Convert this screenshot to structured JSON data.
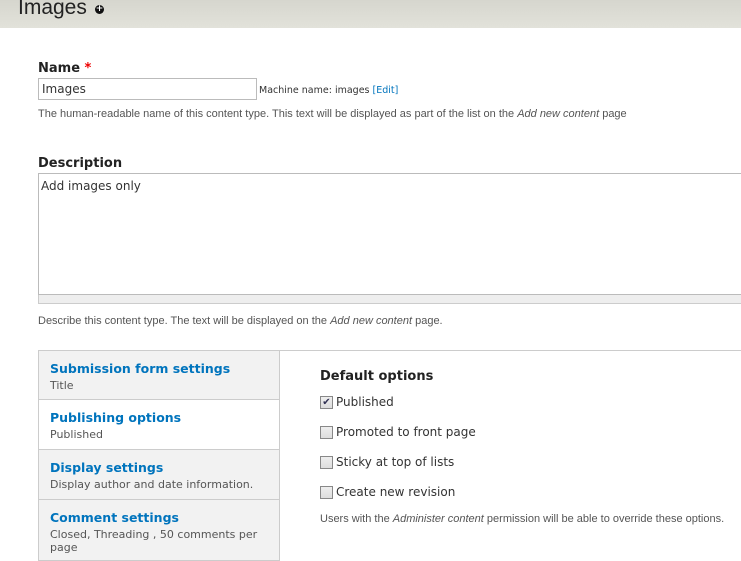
{
  "header": {
    "title": "Images",
    "add_icon": "plus-circle-icon"
  },
  "name": {
    "label": "Name",
    "required": "*",
    "value": "Images",
    "machine_prefix": "Machine name: images",
    "machine_edit": "[Edit]",
    "help_pre": "The human-readable name of this content type. This text will be displayed as part of the list on the ",
    "help_em": "Add new content",
    "help_post": " page"
  },
  "description": {
    "label": "Description",
    "value": "Add images only",
    "help_pre": "Describe this content type. The text will be displayed on the ",
    "help_em": "Add new content",
    "help_post": " page."
  },
  "tabs": [
    {
      "title": "Submission form settings",
      "summary": "Title"
    },
    {
      "title": "Publishing options",
      "summary": "Published",
      "selected": true
    },
    {
      "title": "Display settings",
      "summary": "Display author and date information."
    },
    {
      "title": "Comment settings",
      "summary": "Closed, Threading , 50 comments per page"
    }
  ],
  "pane": {
    "heading": "Default options",
    "options": [
      {
        "label": "Published",
        "checked": true
      },
      {
        "label": "Promoted to front page",
        "checked": false
      },
      {
        "label": "Sticky at top of lists",
        "checked": false
      },
      {
        "label": "Create new revision",
        "checked": false
      }
    ],
    "help_pre": "Users with the ",
    "help_em": "Administer content",
    "help_post": " permission will be able to override these options."
  }
}
